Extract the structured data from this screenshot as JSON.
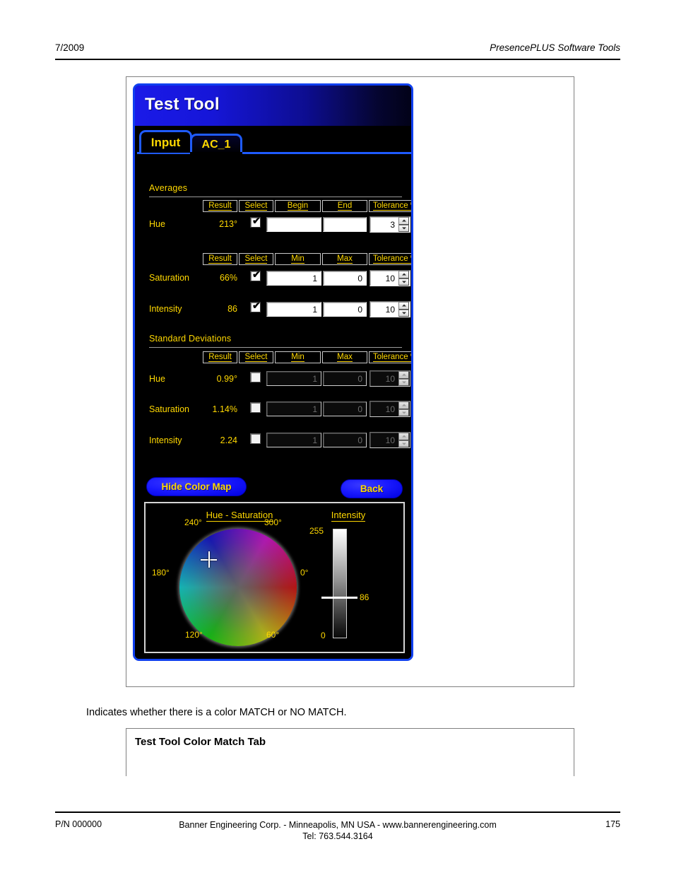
{
  "page": {
    "header_left": "7/2009",
    "header_right": "PresencePLUS Software Tools",
    "body_text": "Indicates whether there is a color MATCH or NO MATCH.",
    "figure_caption": "Test Tool Color Match Tab",
    "footer_left": "P/N 000000",
    "footer_center_line1": "Banner Engineering Corp. - Minneapolis, MN USA - www.bannerengineering.com",
    "footer_center_line2": "Tel: 763.544.3164",
    "footer_page": "175"
  },
  "dialog": {
    "title": "Test Tool",
    "tabs": [
      {
        "label": "Input",
        "active": false
      },
      {
        "label": "AC_1",
        "active": true
      }
    ],
    "buttons": {
      "hide_color_map": "Hide Color Map",
      "back": "Back"
    },
    "averages": {
      "section_label": "Averages",
      "headers_hue": [
        "Result",
        "Select",
        "Begin",
        "End",
        "Tolerance %"
      ],
      "headers_si": [
        "Result",
        "Select",
        "Min",
        "Max",
        "Tolerance %"
      ],
      "rows": [
        {
          "label": "Hue",
          "result": "213°",
          "selected": true,
          "enabled": true,
          "begin": "",
          "end": "",
          "tolerance": "3"
        },
        {
          "label": "Saturation",
          "result": "66%",
          "selected": true,
          "enabled": true,
          "min": "1",
          "max": "0",
          "tolerance": "10"
        },
        {
          "label": "Intensity",
          "result": "86",
          "selected": true,
          "enabled": true,
          "min": "1",
          "max": "0",
          "tolerance": "10"
        }
      ]
    },
    "standard_deviations": {
      "section_label": "Standard Deviations",
      "headers": [
        "Result",
        "Select",
        "Min",
        "Max",
        "Tolerance %"
      ],
      "rows": [
        {
          "label": "Hue",
          "result": "0.99°",
          "selected": false,
          "enabled": false,
          "min": "1",
          "max": "0",
          "tolerance": "10"
        },
        {
          "label": "Saturation",
          "result": "1.14%",
          "selected": false,
          "enabled": false,
          "min": "1",
          "max": "0",
          "tolerance": "10"
        },
        {
          "label": "Intensity",
          "result": "2.24",
          "selected": false,
          "enabled": false,
          "min": "1",
          "max": "0",
          "tolerance": "10"
        }
      ]
    },
    "color_map": {
      "wheel_title": "Hue - Saturation",
      "intensity_title": "Intensity",
      "hue_ticks": [
        "0°",
        "60°",
        "120°",
        "180°",
        "240°",
        "300°"
      ],
      "intensity_max": "255",
      "intensity_min": "0",
      "intensity_value": "86",
      "marker_hue_deg": 213,
      "marker_saturation_pct": 66
    },
    "colors": {
      "accent_blue": "#1f5bff",
      "text_yellow": "#ffd800",
      "title_bar_blue": "#1a1ae8",
      "panel_black": "#000000"
    }
  }
}
